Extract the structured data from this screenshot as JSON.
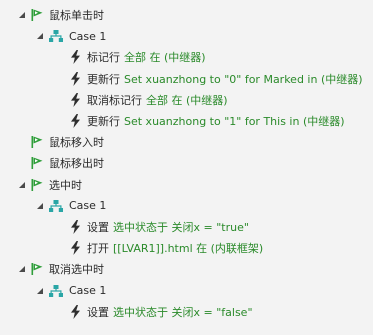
{
  "colors": {
    "text": "#2b2b2b",
    "highlight": "#2a8a2a",
    "event_flag": "#2f9e3a",
    "case_icon": "#2aa6a6",
    "action_icon": "#2e2e2e",
    "background": "#f3f3f3"
  },
  "events": [
    {
      "label": "鼠标单击时",
      "expanded": true,
      "cases": [
        {
          "label": "Case 1",
          "actions": [
            {
              "verb": "标记行",
              "detail": "全部 在 (中继器)"
            },
            {
              "verb": "更新行",
              "detail": "Set xuanzhong to \"0\" for Marked in (中继器)"
            },
            {
              "verb": "取消标记行",
              "detail": "全部 在 (中继器)"
            },
            {
              "verb": "更新行",
              "detail": "Set xuanzhong to \"1\" for This in (中继器)"
            }
          ]
        }
      ]
    },
    {
      "label": "鼠标移入时",
      "expanded": false,
      "cases": []
    },
    {
      "label": "鼠标移出时",
      "expanded": false,
      "cases": []
    },
    {
      "label": "选中时",
      "expanded": true,
      "cases": [
        {
          "label": "Case 1",
          "actions": [
            {
              "verb": "设置",
              "detail": "选中状态于 关闭x = \"true\""
            },
            {
              "verb": "打开",
              "detail": "[[LVAR1]].html 在 (内联框架)"
            }
          ]
        }
      ]
    },
    {
      "label": "取消选中时",
      "expanded": true,
      "cases": [
        {
          "label": "Case 1",
          "actions": [
            {
              "verb": "设置",
              "detail": "选中状态于 关闭x = \"false\""
            }
          ]
        }
      ]
    }
  ]
}
